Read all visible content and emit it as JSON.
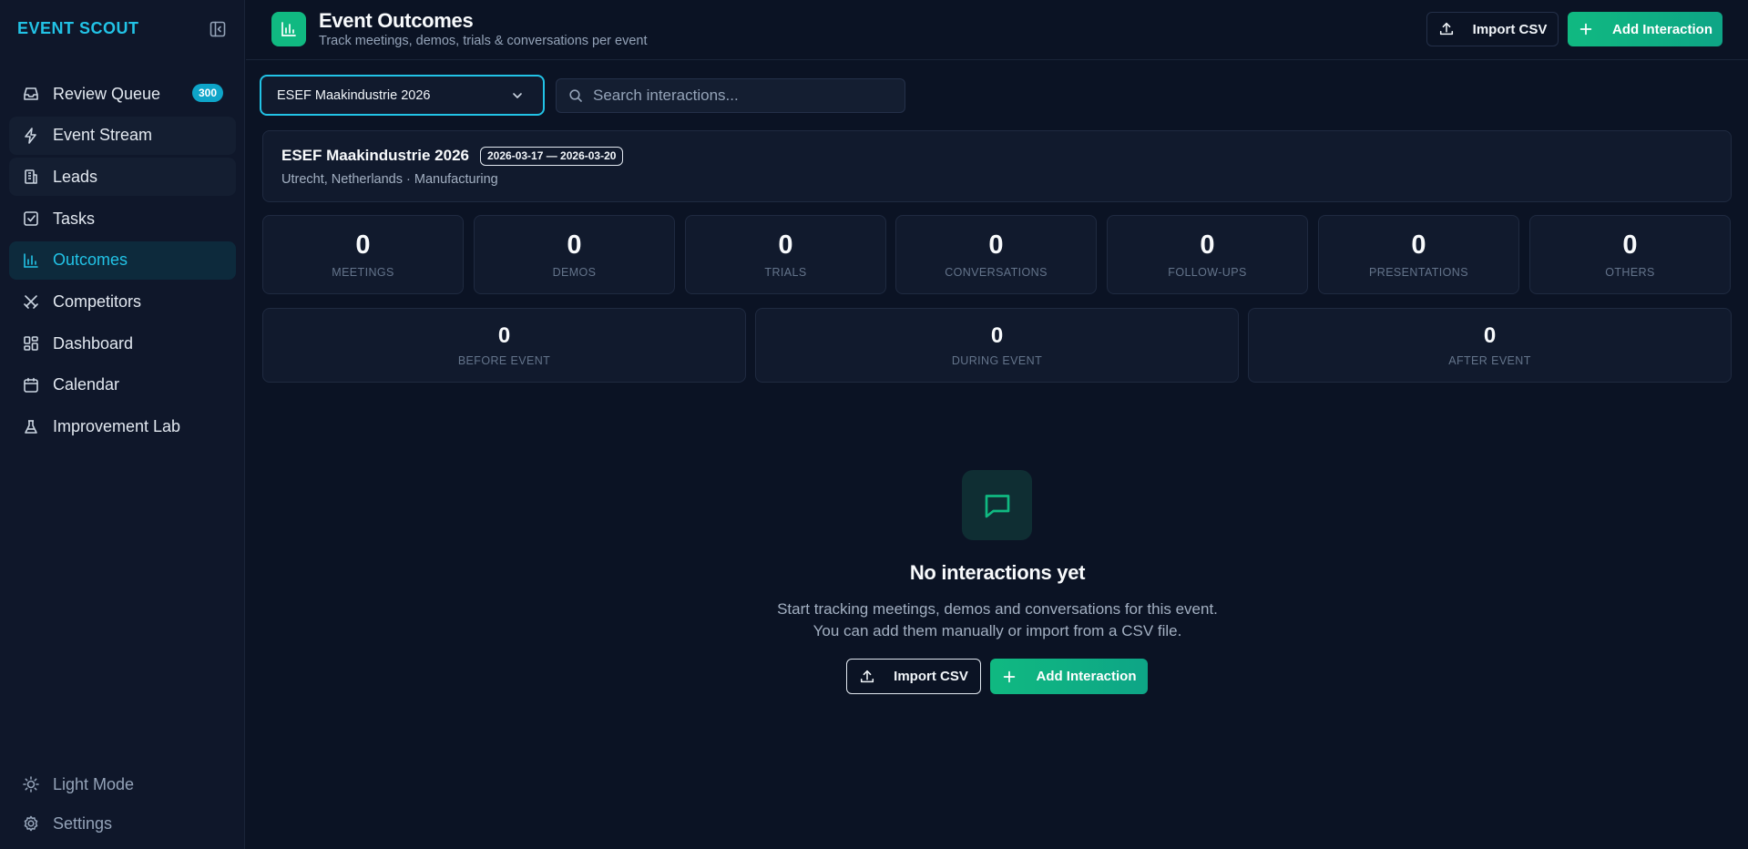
{
  "brand": "EVENT SCOUT",
  "sidebar": {
    "items": [
      {
        "label": "Review Queue",
        "badge": "300"
      },
      {
        "label": "Event Stream"
      },
      {
        "label": "Leads"
      },
      {
        "label": "Tasks"
      },
      {
        "label": "Outcomes"
      },
      {
        "label": "Competitors"
      },
      {
        "label": "Dashboard"
      },
      {
        "label": "Calendar"
      },
      {
        "label": "Improvement Lab"
      }
    ],
    "active": "Outcomes",
    "bottom": [
      {
        "label": "Light Mode"
      },
      {
        "label": "Settings"
      }
    ]
  },
  "header": {
    "title": "Event Outcomes",
    "subtitle": "Track meetings, demos, trials & conversations per event",
    "import_label": "Import CSV",
    "add_label": "Add Interaction"
  },
  "filters": {
    "selected_event": "ESEF Maakindustrie 2026",
    "search_placeholder": "Search interactions..."
  },
  "event": {
    "name": "ESEF Maakindustrie 2026",
    "dates": "2026-03-17 — 2026-03-20",
    "meta": "Utrecht, Netherlands · Manufacturing"
  },
  "stats": [
    {
      "value": "0",
      "label": "MEETINGS"
    },
    {
      "value": "0",
      "label": "DEMOS"
    },
    {
      "value": "0",
      "label": "TRIALS"
    },
    {
      "value": "0",
      "label": "CONVERSATIONS"
    },
    {
      "value": "0",
      "label": "FOLLOW-UPS"
    },
    {
      "value": "0",
      "label": "PRESENTATIONS"
    },
    {
      "value": "0",
      "label": "OTHERS"
    }
  ],
  "phases": [
    {
      "value": "0",
      "label": "BEFORE EVENT"
    },
    {
      "value": "0",
      "label": "DURING EVENT"
    },
    {
      "value": "0",
      "label": "AFTER EVENT"
    }
  ],
  "empty": {
    "title": "No interactions yet",
    "line1": "Start tracking meetings, demos and conversations for this event.",
    "line2": "You can add them manually or import from a CSV file.",
    "import_label": "Import CSV",
    "add_label": "Add Interaction"
  },
  "colors": {
    "accent": "#22c3e6",
    "primary": "#10b981",
    "background": "#0b1324",
    "sidebar": "#0f172a"
  }
}
